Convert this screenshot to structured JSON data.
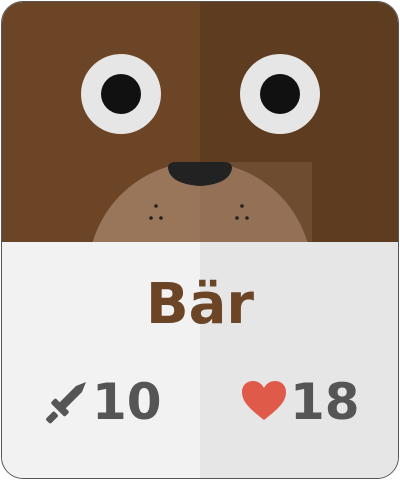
{
  "card": {
    "name": "Bär",
    "attack": {
      "icon": "sword-icon",
      "value": "10"
    },
    "health": {
      "icon": "heart-icon",
      "value": "18"
    }
  },
  "colors": {
    "fur_left": "#6b4526",
    "fur_right": "#5e3c20",
    "muzzle": "#997559",
    "nose": "#222222",
    "eye_white": "#e6e6e6",
    "name_text": "#6b4526",
    "stat_text": "#555555",
    "heart": "#e05a4a",
    "sword": "#555555"
  }
}
